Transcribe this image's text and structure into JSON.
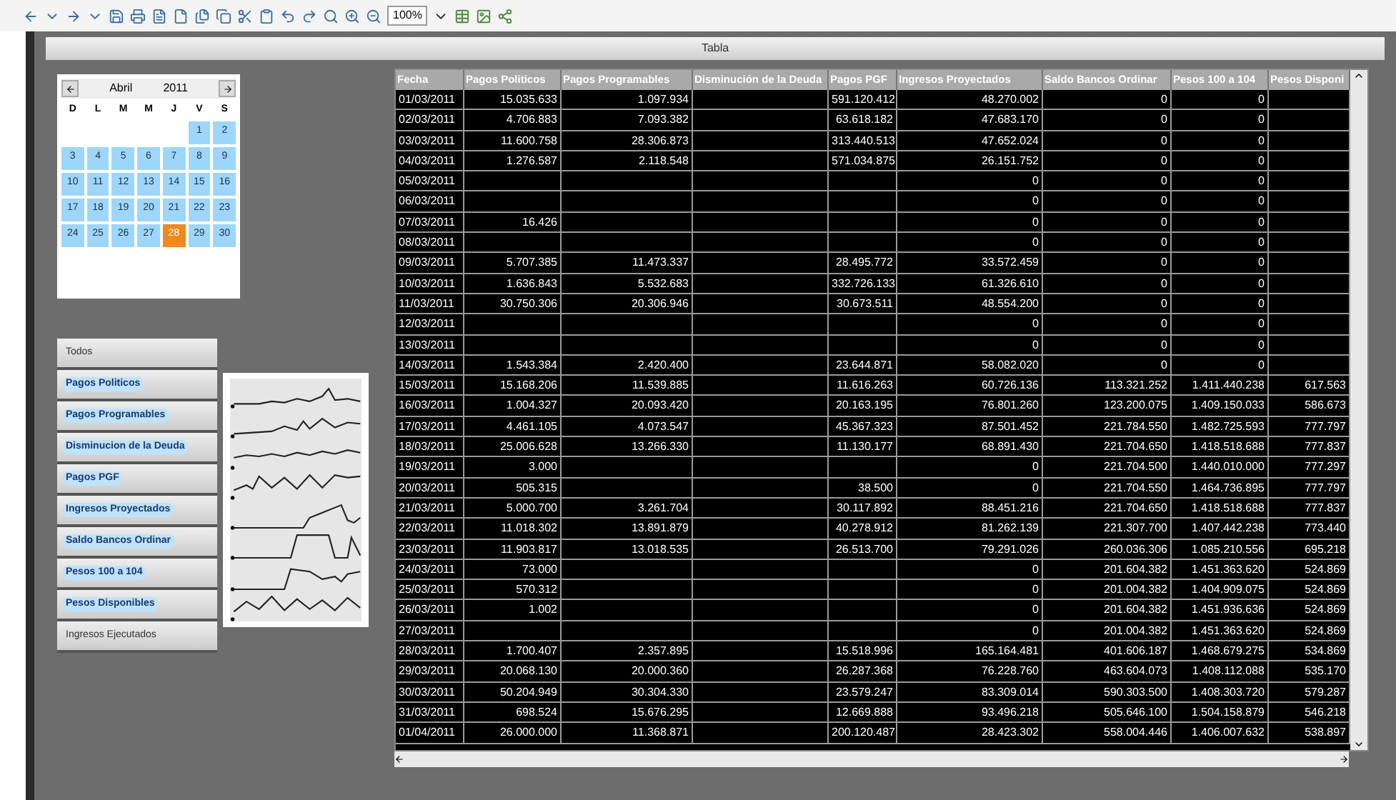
{
  "toolbar": {
    "zoom": "100%"
  },
  "window": {
    "title": "Tabla"
  },
  "calendar": {
    "month": "Abril",
    "year": "2011",
    "weekdays": [
      "D",
      "L",
      "M",
      "M",
      "J",
      "V",
      "S"
    ],
    "days": [
      {
        "label": "1",
        "selected": false
      },
      {
        "label": "2",
        "selected": false
      },
      {
        "label": "3",
        "selected": false
      },
      {
        "label": "4",
        "selected": false
      },
      {
        "label": "5",
        "selected": false
      },
      {
        "label": "6",
        "selected": false
      },
      {
        "label": "7",
        "selected": false
      },
      {
        "label": "8",
        "selected": false
      },
      {
        "label": "9",
        "selected": false
      },
      {
        "label": "10",
        "selected": false
      },
      {
        "label": "11",
        "selected": false
      },
      {
        "label": "12",
        "selected": false
      },
      {
        "label": "13",
        "selected": false
      },
      {
        "label": "14",
        "selected": false
      },
      {
        "label": "15",
        "selected": false
      },
      {
        "label": "16",
        "selected": false
      },
      {
        "label": "17",
        "selected": false
      },
      {
        "label": "18",
        "selected": false
      },
      {
        "label": "19",
        "selected": false
      },
      {
        "label": "20",
        "selected": false
      },
      {
        "label": "21",
        "selected": false
      },
      {
        "label": "22",
        "selected": false
      },
      {
        "label": "23",
        "selected": false
      },
      {
        "label": "24",
        "selected": false
      },
      {
        "label": "25",
        "selected": false
      },
      {
        "label": "26",
        "selected": false
      },
      {
        "label": "27",
        "selected": false
      },
      {
        "label": "28",
        "selected": true
      },
      {
        "label": "29",
        "selected": false
      },
      {
        "label": "30",
        "selected": false
      }
    ]
  },
  "series_list": [
    {
      "label": "Todos",
      "selected": false
    },
    {
      "label": "Pagos Politicos",
      "selected": true
    },
    {
      "label": "Pagos Programables",
      "selected": true
    },
    {
      "label": "Disminucion de la Deuda",
      "selected": true
    },
    {
      "label": "Pagos PGF",
      "selected": true
    },
    {
      "label": "Ingresos Proyectados",
      "selected": true
    },
    {
      "label": "Saldo Bancos Ordinar",
      "selected": true
    },
    {
      "label": "Pesos 100 a 104",
      "selected": true
    },
    {
      "label": "Pesos Disponibles",
      "selected": true
    },
    {
      "label": "Ingresos Ejecutados",
      "selected": false
    }
  ],
  "table": {
    "columns": [
      "Fecha",
      "Pagos Politicos",
      "Pagos Programables",
      "Disminución de la Deuda",
      "Pagos PGF",
      "Ingresos Proyectados",
      "Saldo Bancos Ordinar",
      "Pesos 100 a 104",
      "Pesos Disponi"
    ],
    "rows": [
      [
        "01/03/2011",
        "15.035.633",
        "1.097.934",
        null,
        "591.120.412",
        "48.270.002",
        "0",
        "0",
        null
      ],
      [
        "02/03/2011",
        "4.706.883",
        "7.093.382",
        null,
        "63.618.182",
        "47.683.170",
        "0",
        "0",
        null
      ],
      [
        "03/03/2011",
        "11.600.758",
        "28.306.873",
        null,
        "313.440.513",
        "47.652.024",
        "0",
        "0",
        null
      ],
      [
        "04/03/2011",
        "1.276.587",
        "2.118.548",
        null,
        "571.034.875",
        "26.151.752",
        "0",
        "0",
        null
      ],
      [
        "05/03/2011",
        null,
        null,
        null,
        null,
        "0",
        "0",
        "0",
        null
      ],
      [
        "06/03/2011",
        null,
        null,
        null,
        null,
        "0",
        "0",
        "0",
        null
      ],
      [
        "07/03/2011",
        "16.426",
        null,
        null,
        null,
        "0",
        "0",
        "0",
        null
      ],
      [
        "08/03/2011",
        null,
        null,
        null,
        null,
        "0",
        "0",
        "0",
        null
      ],
      [
        "09/03/2011",
        "5.707.385",
        "11.473.337",
        null,
        "28.495.772",
        "33.572.459",
        "0",
        "0",
        null
      ],
      [
        "10/03/2011",
        "1.636.843",
        "5.532.683",
        null,
        "332.726.133",
        "61.326.610",
        "0",
        "0",
        null
      ],
      [
        "11/03/2011",
        "30.750.306",
        "20.306.946",
        null,
        "30.673.511",
        "48.554.200",
        "0",
        "0",
        null
      ],
      [
        "12/03/2011",
        null,
        null,
        null,
        null,
        "0",
        "0",
        "0",
        null
      ],
      [
        "13/03/2011",
        null,
        null,
        null,
        null,
        "0",
        "0",
        "0",
        null
      ],
      [
        "14/03/2011",
        "1.543.384",
        "2.420.400",
        null,
        "23.644.871",
        "58.082.020",
        "0",
        "0",
        null
      ],
      [
        "15/03/2011",
        "15.168.206",
        "11.539.885",
        null,
        "11.616.263",
        "60.726.136",
        "113.321.252",
        "1.411.440.238",
        "617.563"
      ],
      [
        "16/03/2011",
        "1.004.327",
        "20.093.420",
        null,
        "20.163.195",
        "76.801.260",
        "123.200.075",
        "1.409.150.033",
        "586.673"
      ],
      [
        "17/03/2011",
        "4.461.105",
        "4.073.547",
        null,
        "45.367.323",
        "87.501.452",
        "221.784.550",
        "1.482.725.593",
        "777.797"
      ],
      [
        "18/03/2011",
        "25.006.628",
        "13.266.330",
        null,
        "11.130.177",
        "68.891.430",
        "221.704.650",
        "1.418.518.688",
        "777.837"
      ],
      [
        "19/03/2011",
        "3.000",
        null,
        null,
        null,
        "0",
        "221.704.500",
        "1.440.010.000",
        "777.297"
      ],
      [
        "20/03/2011",
        "505.315",
        null,
        null,
        "38.500",
        "0",
        "221.704.550",
        "1.464.736.895",
        "777.797"
      ],
      [
        "21/03/2011",
        "5.000.700",
        "3.261.704",
        null,
        "30.117.892",
        "88.451.216",
        "221.704.650",
        "1.418.518.688",
        "777.837"
      ],
      [
        "22/03/2011",
        "11.018.302",
        "13.891.879",
        null,
        "40.278.912",
        "81.262.139",
        "221.307.700",
        "1.407.442.238",
        "773.440"
      ],
      [
        "23/03/2011",
        "11.903.817",
        "13.018.535",
        null,
        "26.513.700",
        "79.291.026",
        "260.036.306",
        "1.085.210.556",
        "695.218"
      ],
      [
        "24/03/2011",
        "73.000",
        null,
        null,
        null,
        "0",
        "201.604.382",
        "1.451.363.620",
        "524.869"
      ],
      [
        "25/03/2011",
        "570.312",
        null,
        null,
        null,
        "0",
        "201.004.382",
        "1.404.909.075",
        "524.869"
      ],
      [
        "26/03/2011",
        "1.002",
        null,
        null,
        null,
        "0",
        "201.604.382",
        "1.451.936.636",
        "524.869"
      ],
      [
        "27/03/2011",
        null,
        null,
        null,
        null,
        "0",
        "201.004.382",
        "1.451.363.620",
        "524.869"
      ],
      [
        "28/03/2011",
        "1.700.407",
        "2.357.895",
        null,
        "15.518.996",
        "165.164.481",
        "401.606.187",
        "1.468.679.275",
        "534.869"
      ],
      [
        "29/03/2011",
        "20.068.130",
        "20.000.360",
        null,
        "26.287.368",
        "76.228.760",
        "463.604.073",
        "1.408.112.088",
        "535.170"
      ],
      [
        "30/03/2011",
        "50.204.949",
        "30.304.330",
        null,
        "23.579.247",
        "83.309.014",
        "590.303.500",
        "1.408.303.720",
        "579.287"
      ],
      [
        "31/03/2011",
        "698.524",
        "15.676.295",
        null,
        "12.669.888",
        "93.496.218",
        "505.646.100",
        "1.504.158.879",
        "546.218"
      ],
      [
        "01/04/2011",
        "26.000.000",
        "11.368.871",
        null,
        "200.120.487",
        "28.423.302",
        "558.004.446",
        "1.406.007.632",
        "538.897"
      ]
    ]
  }
}
